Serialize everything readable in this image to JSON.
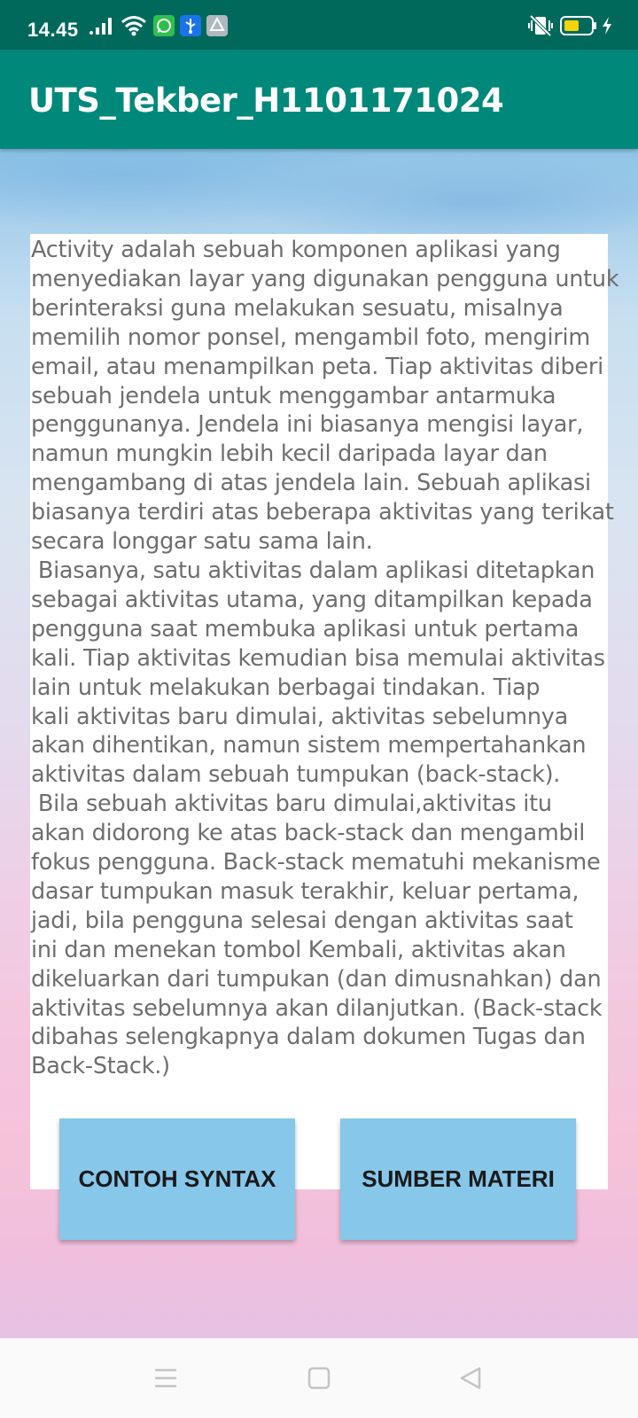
{
  "status_bar": {
    "time": "14.45",
    "icons": [
      "signal-icon",
      "wifi-icon",
      "whatsapp-icon",
      "usb-icon",
      "drive-icon",
      "vibrate-icon",
      "battery-icon",
      "charging-icon"
    ]
  },
  "app_bar": {
    "title": "UTS_Tekber_H1101171024"
  },
  "content": {
    "text": "Activity adalah sebuah komponen aplikasi yang\nmenyediakan layar yang digunakan pengguna untuk\nberinteraksi guna melakukan sesuatu, misalnya\nmemilih nomor ponsel, mengambil foto, mengirim\nemail, atau menampilkan peta. Tiap aktivitas diberi\nsebuah jendela untuk menggambar antarmuka\npenggunanya. Jendela ini biasanya mengisi layar,\nnamun mungkin lebih kecil daripada layar dan\nmengambang di atas jendela lain. Sebuah aplikasi\nbiasanya terdiri atas beberapa aktivitas yang terikat\nsecara longgar satu sama lain.\n Biasanya, satu aktivitas dalam aplikasi ditetapkan\nsebagai aktivitas utama, yang ditampilkan kepada\npengguna saat membuka aplikasi untuk pertama\nkali. Tiap aktivitas kemudian bisa memulai aktivitas\nlain untuk melakukan berbagai tindakan. Tiap\nkali aktivitas baru dimulai, aktivitas sebelumnya\nakan dihentikan, namun sistem mempertahankan\naktivitas dalam sebuah tumpukan (back-stack).\n Bila sebuah aktivitas baru dimulai,aktivitas itu\nakan didorong ke atas back-stack dan mengambil\nfokus pengguna. Back-stack mematuhi mekanisme\ndasar tumpukan masuk terakhir, keluar pertama,\njadi, bila pengguna selesai dengan aktivitas saat\nini dan menekan tombol Kembali, aktivitas akan\ndikeluarkan dari tumpukan (dan dimusnahkan) dan\naktivitas sebelumnya akan dilanjutkan. (Back-stack\ndibahas selengkapnya dalam dokumen Tugas dan\nBack-Stack.)"
  },
  "buttons": {
    "contoh_syntax": "CONTOH SYNTAX",
    "sumber_materi": "SUMBER MATERI"
  },
  "nav_bar": {
    "icons": [
      "menu-icon",
      "home-icon",
      "back-icon"
    ]
  },
  "colors": {
    "status_bar": "#00695c",
    "app_bar": "#00897b",
    "button": "#87c7ea"
  }
}
